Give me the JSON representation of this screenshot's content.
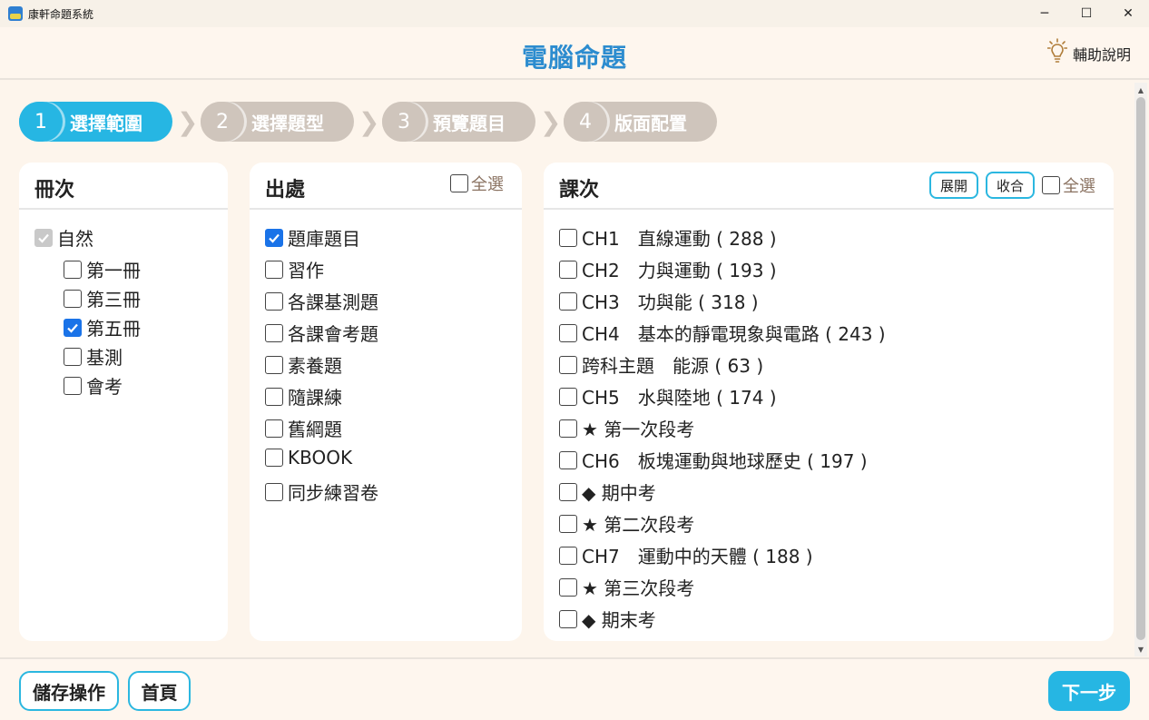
{
  "window": {
    "title": "康軒命題系統",
    "minimize": "─",
    "maximize": "☐",
    "close": "✕"
  },
  "header": {
    "title": "電腦命題",
    "help_label": "輔助說明"
  },
  "steps": [
    {
      "num": "1",
      "label": "選擇範圍",
      "active": true
    },
    {
      "num": "2",
      "label": "選擇題型",
      "active": false
    },
    {
      "num": "3",
      "label": "預覽題目",
      "active": false
    },
    {
      "num": "4",
      "label": "版面配置",
      "active": false
    }
  ],
  "panels": {
    "volumes": {
      "title": "冊次",
      "root": {
        "label": "自然",
        "checked": true,
        "disabled": true
      },
      "items": [
        {
          "label": "第一冊",
          "checked": false
        },
        {
          "label": "第三冊",
          "checked": false
        },
        {
          "label": "第五冊",
          "checked": true
        },
        {
          "label": "基測",
          "checked": false
        },
        {
          "label": "會考",
          "checked": false
        }
      ]
    },
    "sources": {
      "title": "出處",
      "select_all": "全選",
      "items": [
        {
          "label": "題庫題目",
          "checked": true
        },
        {
          "label": "習作",
          "checked": false
        },
        {
          "label": "各課基測題",
          "checked": false
        },
        {
          "label": "各課會考題",
          "checked": false
        },
        {
          "label": "素養題",
          "checked": false
        },
        {
          "label": "隨課練",
          "checked": false
        },
        {
          "label": "舊綱題",
          "checked": false
        },
        {
          "label": "KBOOK",
          "checked": false
        },
        {
          "label": "同步練習卷",
          "checked": false
        }
      ]
    },
    "lessons": {
      "title": "課次",
      "expand": "展開",
      "collapse": "收合",
      "select_all": "全選",
      "items": [
        {
          "label": "CH1　直線運動 ( 288 )",
          "checked": false
        },
        {
          "label": "CH2　力與運動 ( 193 )",
          "checked": false
        },
        {
          "label": "CH3　功與能 ( 318 )",
          "checked": false
        },
        {
          "label": "CH4　基本的靜電現象與電路 ( 243 )",
          "checked": false
        },
        {
          "label": "跨科主題　能源 ( 63 )",
          "checked": false
        },
        {
          "label": "CH5　水與陸地 ( 174 )",
          "checked": false
        },
        {
          "label": "★ 第一次段考",
          "checked": false
        },
        {
          "label": "CH6　板塊運動與地球歷史 ( 197 )",
          "checked": false
        },
        {
          "label": "◆ 期中考",
          "checked": false
        },
        {
          "label": "★ 第二次段考",
          "checked": false
        },
        {
          "label": "CH7　運動中的天體 ( 188 )",
          "checked": false
        },
        {
          "label": "★ 第三次段考",
          "checked": false
        },
        {
          "label": "◆ 期末考",
          "checked": false
        }
      ]
    }
  },
  "footer": {
    "save_label": "儲存操作",
    "home_label": "首頁",
    "next_label": "下一步"
  },
  "colors": {
    "accent": "#26b6e3",
    "title_blue": "#2c8ccf",
    "inactive_step": "#cfc5bc",
    "background": "#fdf5ec"
  }
}
